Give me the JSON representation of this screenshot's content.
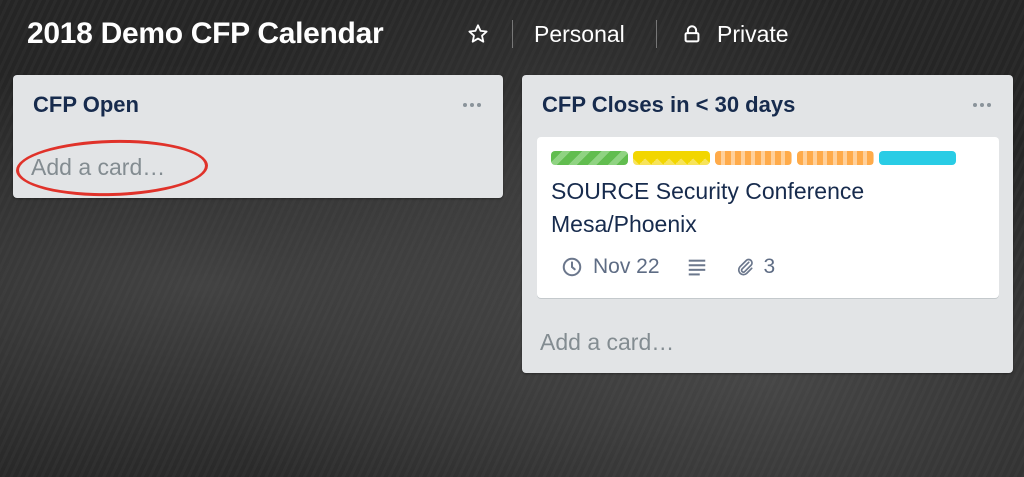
{
  "header": {
    "board_title": "2018 Demo CFP Calendar",
    "star_icon": "star-icon",
    "team_label": "Personal",
    "visibility_icon": "lock-icon",
    "visibility_label": "Private"
  },
  "lists": [
    {
      "title": "CFP Open",
      "menu_icon": "ellipsis-icon",
      "add_card_label": "Add a card…",
      "annotation_color": "#e0322a"
    },
    {
      "title": "CFP Closes in < 30 days",
      "menu_icon": "ellipsis-icon",
      "add_card_label": "Add a card…",
      "cards": [
        {
          "labels": [
            {
              "color": "green",
              "hex": "#61bd4f",
              "pattern": "striped"
            },
            {
              "color": "yellow",
              "hex": "#f2d600",
              "pattern": "zigzag"
            },
            {
              "color": "orange",
              "hex": "#ffab4a",
              "pattern": "striped"
            },
            {
              "color": "orange",
              "hex": "#ffab4a",
              "pattern": "striped"
            },
            {
              "color": "sky",
              "hex": "#29cce5",
              "pattern": "solid"
            }
          ],
          "title": "SOURCE Security Conference Mesa/Phoenix",
          "due_icon": "clock-icon",
          "due_date": "Nov 22",
          "description_icon": "description-icon",
          "attachment_icon": "paperclip-icon",
          "attachment_count": "3"
        }
      ]
    }
  ]
}
